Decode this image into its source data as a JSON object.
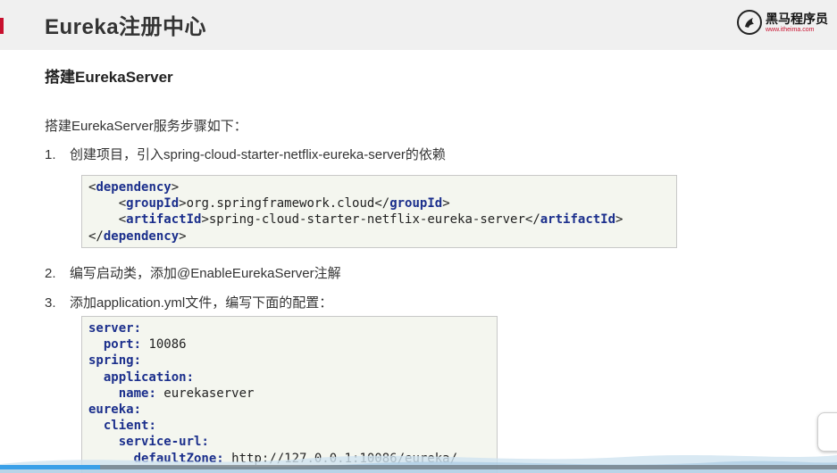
{
  "header": {
    "title": "Eureka注册中心",
    "logo_brand": "黑马程序员",
    "logo_url": "www.itheima.com"
  },
  "section_title": "搭建EurekaServer",
  "intro": "搭建EurekaServer服务步骤如下：",
  "steps": [
    {
      "num": "1.",
      "text": "创建项目，引入spring-cloud-starter-netflix-eureka-server的依赖"
    },
    {
      "num": "2.",
      "text": "编写启动类，添加@EnableEurekaServer注解"
    },
    {
      "num": "3.",
      "text": "添加application.yml文件，编写下面的配置："
    }
  ],
  "code1": {
    "l1_open": "<",
    "l1_tag": "dependency",
    "l1_close": ">",
    "l2_open": "    <",
    "l2_tag": "groupId",
    "l2_mid": ">org.springframework.cloud</",
    "l2_tag2": "groupId",
    "l2_close": ">",
    "l3_open": "    <",
    "l3_tag": "artifactId",
    "l3_mid": ">spring-cloud-starter-netflix-eureka-server</",
    "l3_tag2": "artifactId",
    "l3_close": ">",
    "l4_open": "</",
    "l4_tag": "dependency",
    "l4_close": ">"
  },
  "code2": {
    "server_key": "server",
    "port_key": "  port",
    "port_val": " 10086",
    "spring_key": "spring",
    "application_key": "  application",
    "name_key": "    name",
    "name_val": " eurekaserver",
    "eureka_key": "eureka",
    "client_key": "  client",
    "service_url_key": "    service-url",
    "default_zone_key": "      defaultZone",
    "default_zone_val": " http://127.0.0.1:10086/eureka/",
    "colon": ":"
  },
  "player": {
    "progress_fraction": 0.12,
    "accent": "#3aa0e8"
  }
}
